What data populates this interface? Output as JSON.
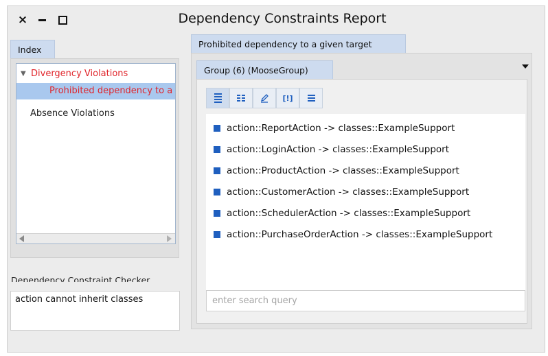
{
  "window": {
    "title": "Dependency Constraints Report"
  },
  "index_tab": {
    "label": "Index"
  },
  "tree": {
    "items": [
      {
        "label": "Divergency Violations"
      },
      {
        "label": "Prohibited dependency to a given target"
      },
      {
        "label": "Absence Violations"
      }
    ]
  },
  "checker": {
    "label": "Dependency Constraint Checker",
    "text": "action cannot inherit classes"
  },
  "right_tab": {
    "label": "Prohibited dependency to a given target"
  },
  "group_tab": {
    "label": "Group (6) (MooseGroup)"
  },
  "toolbar": {
    "buttons": [
      "list-view-icon",
      "table-view-icon",
      "edit-icon",
      "raw-icon",
      "lines-view-icon"
    ],
    "raw_glyph": "[!]"
  },
  "results": {
    "items": [
      "action::ReportAction -> classes::ExampleSupport",
      "action::LoginAction -> classes::ExampleSupport",
      "action::ProductAction -> classes::ExampleSupport",
      "action::CustomerAction -> classes::ExampleSupport",
      "action::SchedulerAction -> classes::ExampleSupport",
      "action::PurchaseOrderAction -> classes::ExampleSupport"
    ]
  },
  "search": {
    "placeholder": "enter search query"
  },
  "colors": {
    "accent": "#1f5fbf",
    "selection": "#a9c8ee",
    "violation_text": "#e0242a",
    "tab": "#cddbef"
  }
}
